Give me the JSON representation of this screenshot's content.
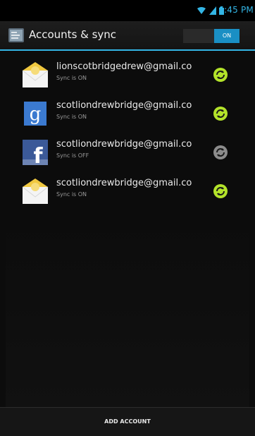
{
  "status_bar": {
    "time": "6:45 PM",
    "icons": [
      "wifi-icon",
      "signal-icon",
      "battery-icon"
    ]
  },
  "action_bar": {
    "title": "Accounts & sync",
    "toggle_label": "ON"
  },
  "accounts": [
    {
      "email": "lionscotbridgedrew@gmail.co",
      "status": "Sync is ON",
      "icon": "email-icon",
      "sync_on": true
    },
    {
      "email": "scotliondrewbridge@gmail.co",
      "status": "Sync is ON",
      "icon": "google-icon",
      "sync_on": true
    },
    {
      "email": "scotliondrewbridge@gmail.co",
      "status": "Sync is OFF",
      "icon": "facebook-icon",
      "sync_on": false
    },
    {
      "email": "scotliondrewbridge@gmail.co",
      "status": "Sync is ON",
      "icon": "email-icon",
      "sync_on": true
    }
  ],
  "footer": {
    "add_account_label": "ADD ACCOUNT"
  },
  "colors": {
    "accent": "#33b5e5",
    "sync_on": "#b3e32a",
    "sync_off": "#8c8c8c"
  }
}
